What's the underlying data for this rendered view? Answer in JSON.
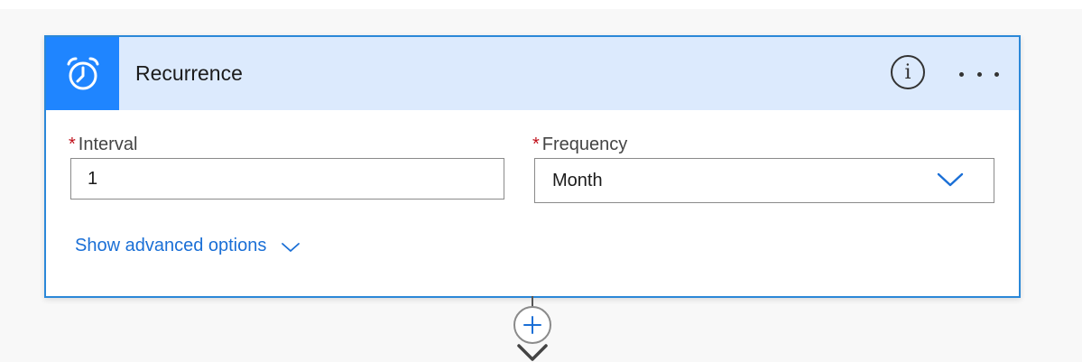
{
  "card": {
    "title": "Recurrence",
    "icon": "alarm-clock-icon",
    "info_icon_glyph": "i",
    "more_icon": "ellipsis-icon"
  },
  "fields": {
    "interval": {
      "required_marker": "*",
      "label": "Interval",
      "value": "1"
    },
    "frequency": {
      "required_marker": "*",
      "label": "Frequency",
      "value": "Month"
    }
  },
  "advanced": {
    "label": "Show advanced options"
  },
  "colors": {
    "accent": "#1f85ff",
    "header_bg": "#dceafd",
    "link": "#1a6fd6",
    "required": "#c0101a"
  }
}
